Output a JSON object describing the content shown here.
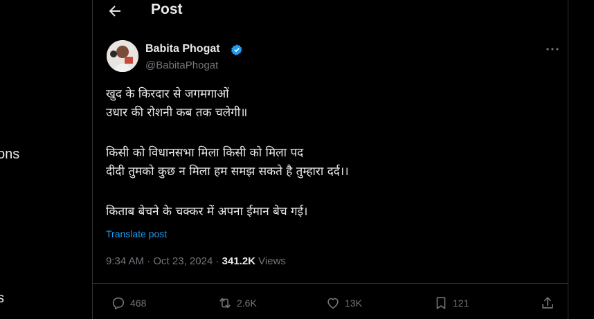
{
  "left_nav": {
    "item_a_fragment": "ons",
    "item_b_fragment": "s"
  },
  "header": {
    "title": "Post"
  },
  "author": {
    "name": "Babita Phogat",
    "handle": "@BabitaPhogat"
  },
  "tweet": {
    "lines": [
      "खुद के किरदार से जगमगाओं",
      "उधार की रोशनी कब तक चलेगी॥",
      "किसी को विधानसभा मिला किसी को मिला पद",
      "दीदी तुमको कुछ न मिला हम समझ सकते है तुम्हारा दर्द।।",
      "किताब बेचने के चक्कर में अपना ईमान बेच गई।"
    ],
    "translate_label": "Translate post"
  },
  "meta": {
    "time": "9:34 AM",
    "separator": " · ",
    "date": "Oct 23, 2024",
    "views_count": "341.2K",
    "views_label": " Views"
  },
  "actions": {
    "replies": "468",
    "reposts": "2.6K",
    "likes": "13K",
    "bookmarks": "121"
  },
  "colors": {
    "background": "#000000",
    "text": "#e7e9ea",
    "muted": "#71767b",
    "accent": "#1d9bf0",
    "divider": "#2f3336"
  },
  "icons": {
    "back": "arrow-left-icon",
    "verified": "verified-badge-icon",
    "more": "more-horizontal-icon",
    "reply": "reply-icon",
    "repost": "repost-icon",
    "like": "heart-icon",
    "bookmark": "bookmark-icon",
    "share": "share-icon"
  }
}
